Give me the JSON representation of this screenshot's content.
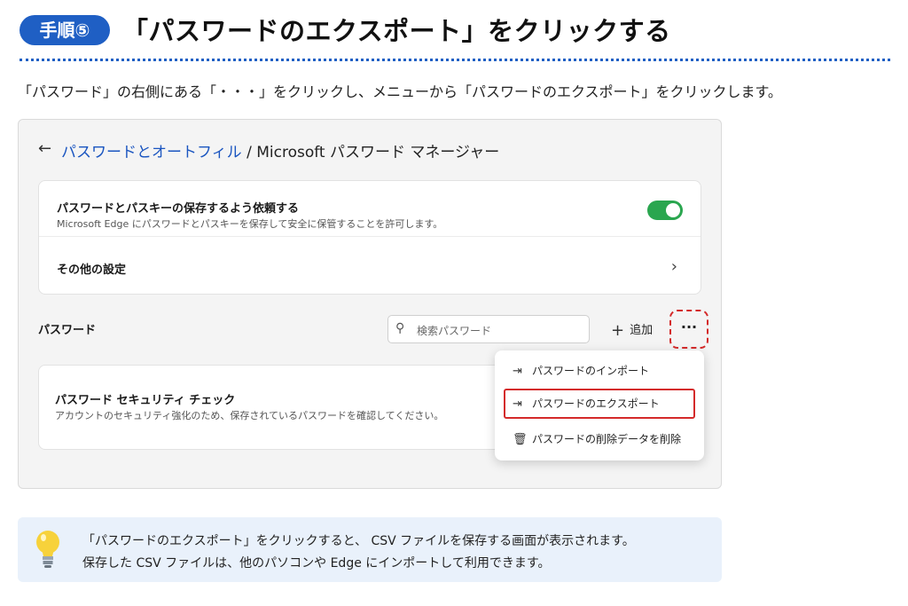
{
  "header": {
    "step_badge": "手順⑤",
    "title": "「パスワードのエクスポート」をクリックする"
  },
  "instruction": "「パスワード」の右側にある「・・・」をクリックし、メニューから「パスワードのエクスポート」をクリックします。",
  "screenshot": {
    "breadcrumb": {
      "back_icon": "arrow-left-icon",
      "link": "パスワードとオートフィル",
      "separator": " / ",
      "current": "Microsoft パスワード マネージャー"
    },
    "settings": {
      "save_toggle": {
        "title": "パスワードとパスキーの保存するよう依頼する",
        "description": "Microsoft Edge にパスワードとパスキーを保存して安全に保管することを許可します。",
        "state": "on"
      },
      "other_settings": {
        "label": "その他の設定",
        "icon": "chevron-right-icon"
      }
    },
    "passwords_section": {
      "label": "パスワード",
      "search_placeholder": "検索パスワード",
      "add_label": "追加",
      "more_label": "···"
    },
    "security_check": {
      "title": "パスワード セキュリティ チェック",
      "description": "アカウントのセキュリティ強化のため、保存されているパスワードを確認してください。"
    },
    "menu": {
      "items": [
        {
          "label": "パスワードのインポート",
          "icon": "import-icon"
        },
        {
          "label": "パスワードのエクスポート",
          "icon": "export-icon",
          "highlighted": true
        },
        {
          "label": "パスワードの削除データを削除",
          "icon": "trash-icon"
        }
      ]
    }
  },
  "tip": {
    "icon": "lightbulb-icon",
    "line1": "「パスワードのエクスポート」をクリックすると、 CSV ファイルを保存する画面が表示されます。",
    "line2": "保存した CSV ファイルは、他のパソコンや Edge にインポートして利用できます。"
  },
  "colors": {
    "accent": "#1f5fc4",
    "highlight": "#d42a2a",
    "toggle_on": "#2aa64f",
    "tip_bg": "#e9f1fb"
  }
}
